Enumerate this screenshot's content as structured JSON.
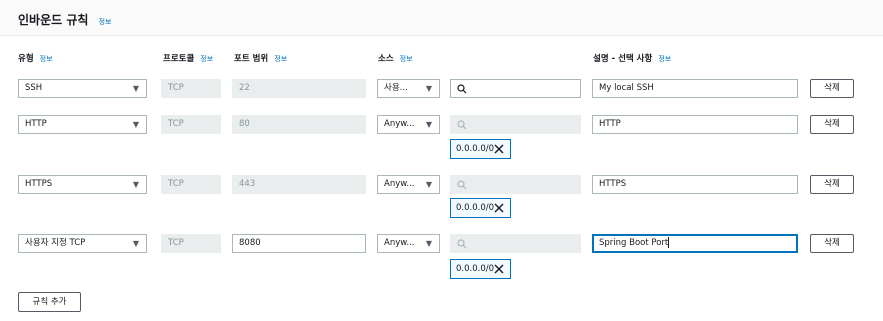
{
  "section": {
    "title": "인바운드 규칙",
    "info": "정보"
  },
  "columns": {
    "type": "유형",
    "protocol": "프로토콜",
    "port_range": "포트 범위",
    "source": "소스",
    "description": "설명 - 선택 사항",
    "info": "정보"
  },
  "rules": [
    {
      "type": "SSH",
      "protocol": "TCP",
      "port": "22",
      "source_type": "사용...",
      "search": "",
      "cidr": "",
      "description": "My local SSH",
      "delete": "삭제"
    },
    {
      "type": "HTTP",
      "protocol": "TCP",
      "port": "80",
      "source_type": "Anyw...",
      "search": "",
      "cidr": "0.0.0.0/0",
      "description": "HTTP",
      "delete": "삭제"
    },
    {
      "type": "HTTPS",
      "protocol": "TCP",
      "port": "443",
      "source_type": "Anyw...",
      "search": "",
      "cidr": "0.0.0.0/0",
      "description": "HTTPS",
      "delete": "삭제"
    },
    {
      "type": "사용자 지정 TCP",
      "protocol": "TCP",
      "port": "8080",
      "source_type": "Anyw...",
      "search": "",
      "cidr": "0.0.0.0/0",
      "description": "Spring Boot Port",
      "delete": "삭제"
    }
  ],
  "add_rule_label": "규칙 추가",
  "icons": {
    "select_arrow": "▼",
    "search": "search-icon",
    "remove": "close-icon"
  },
  "colors": {
    "link": "#0073bb",
    "border": "#aab7b8",
    "disabled_bg": "#eaeded"
  }
}
